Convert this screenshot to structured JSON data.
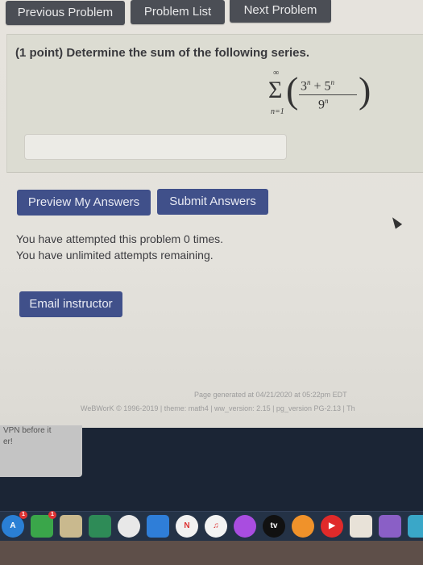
{
  "nav": {
    "previous": "Previous Problem",
    "list": "Problem List",
    "next": "Next Problem"
  },
  "problem": {
    "points": "(1 point)",
    "text": "(1 point) Determine the sum of the following series.",
    "formula": {
      "upper_limit": "∞",
      "lower_limit": "n=1",
      "sigma": "Σ",
      "numerator_a": "3",
      "numerator_b": "5",
      "denominator": "9",
      "exponent": "n",
      "plus": "+"
    },
    "answer_value": ""
  },
  "actions": {
    "preview": "Preview My Answers",
    "submit": "Submit Answers",
    "email": "Email instructor"
  },
  "status": {
    "attempts": "You have attempted this problem 0 times.",
    "remaining": "You have unlimited attempts remaining."
  },
  "footer": {
    "generated": "Page generated at 04/21/2020 at 05:22pm EDT",
    "version": "WeBWorK © 1996-2019 | theme: math4 | ww_version: 2.15 | pg_version PG-2.13 | Th"
  },
  "tooltip": {
    "line1": "VPN before it",
    "line2": "er!"
  },
  "dock": {
    "items": [
      {
        "name": "app-store",
        "label": "A",
        "color": "#2a7fd4",
        "badge": "1"
      },
      {
        "name": "facetime",
        "label": "",
        "color": "#3aa64a",
        "badge": "1"
      },
      {
        "name": "preview",
        "label": "",
        "color": "#c9b98e",
        "badge": ""
      },
      {
        "name": "numbers",
        "label": "",
        "color": "#2e8b57",
        "badge": ""
      },
      {
        "name": "photos",
        "label": "",
        "color": "#e8e8e8",
        "badge": ""
      },
      {
        "name": "keynote",
        "label": "",
        "color": "#2f7ed8",
        "badge": ""
      },
      {
        "name": "news",
        "label": "N",
        "color": "#f1f1f1",
        "badge": ""
      },
      {
        "name": "music",
        "label": "♫",
        "color": "#f3f3f3",
        "badge": ""
      },
      {
        "name": "podcasts",
        "label": "",
        "color": "#a94de0",
        "badge": ""
      },
      {
        "name": "apple-tv",
        "label": "tv",
        "color": "#111111",
        "badge": ""
      },
      {
        "name": "books",
        "label": "",
        "color": "#f0922a",
        "badge": ""
      },
      {
        "name": "youtube",
        "label": "▶",
        "color": "#e02a2a",
        "badge": ""
      },
      {
        "name": "instruments",
        "label": "",
        "color": "#e8e2d8",
        "badge": ""
      },
      {
        "name": "visual-studio",
        "label": "",
        "color": "#8a5fc6",
        "badge": ""
      },
      {
        "name": "finder-folder",
        "label": "",
        "color": "#3aa7c8",
        "badge": ""
      }
    ]
  }
}
